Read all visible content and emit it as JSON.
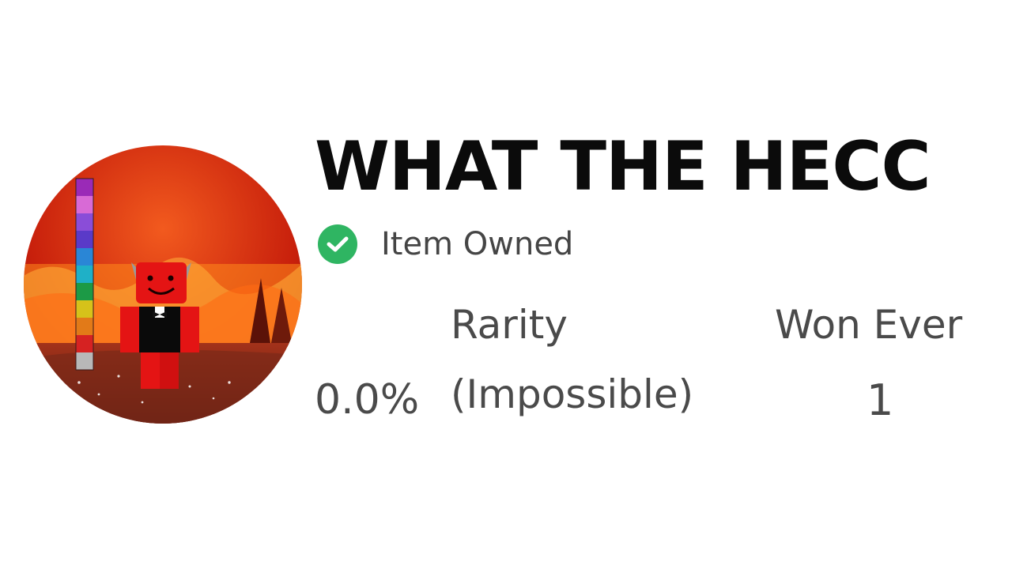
{
  "item": {
    "title": "WHAT THE HECC",
    "owned_label": "Item Owned",
    "owned_icon": "checkmark-icon",
    "owned_color": "#2fb562",
    "badge_image": "lava-scene-red-character"
  },
  "stats": {
    "rarity": {
      "heading": "Rarity",
      "percent": "0.0%",
      "tier": "(Impossible)"
    },
    "won_ever": {
      "heading": "Won Ever",
      "value": "1"
    }
  }
}
